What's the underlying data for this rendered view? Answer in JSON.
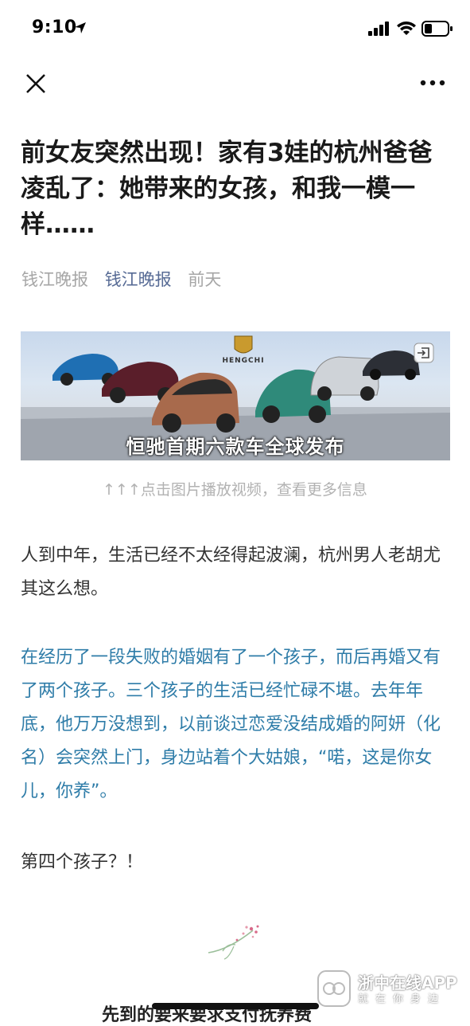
{
  "status_bar": {
    "time": "9:10",
    "icons": [
      "location-arrow-icon",
      "cellular-signal-icon",
      "wifi-icon",
      "battery-icon"
    ]
  },
  "nav": {
    "close_icon": "close-icon",
    "more_icon": "more-icon"
  },
  "article": {
    "title": "前女友突然出现！家有3娃的杭州爸爸凌乱了：她带来的女孩，和我一模一样……",
    "source": "钱江晚报",
    "account": "钱江晚报",
    "time": "前天",
    "banner_caption": "恒驰首期六款车全球发布",
    "banner_logo_text": "HENGCHI",
    "image_note": "↑↑↑点击图片播放视频，查看更多信息",
    "paragraph_1": "人到中年，生活已经不太经得起波澜，杭州男人老胡尤其这么想。",
    "paragraph_2": "在经历了一段失败的婚姻有了一个孩子，而后再婚又有了两个孩子。三个孩子的生活已经忙碌不堪。去年年底，他万万没想到，以前谈过恋爱没结成婚的阿妍（化名）会突然上门，身边站着个大姑娘，“喏，这是你女儿，你养”。",
    "paragraph_3": "第四个孩子？！",
    "paragraph_4_partial": "先到的要来要求支付抚养费"
  },
  "watermark": {
    "title": "浙中在线APP",
    "subtitle": "就在你身边"
  },
  "colors": {
    "link": "#576b95",
    "highlight_text": "#2e7ca8",
    "meta_gray": "#a6a6a6"
  }
}
